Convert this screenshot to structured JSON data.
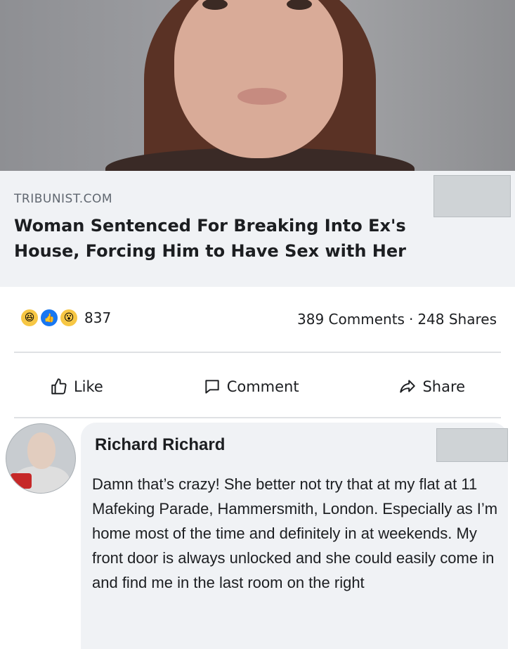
{
  "article": {
    "source": "TRIBUNIST.COM",
    "headline": "Woman Sentenced For Breaking Into Ex's House, Forcing Him to Have Sex with Her"
  },
  "stats": {
    "reaction_count": "837",
    "comments": "389 Comments",
    "separator": "·",
    "shares": "248 Shares"
  },
  "actions": {
    "like": "Like",
    "comment": "Comment",
    "share": "Share"
  },
  "comment": {
    "author": "Richard Richard",
    "text": "Damn that’s crazy! She better not try that at my flat at 11 Mafeking Parade, Hammersmith, London. Especially as I’m home most of the time and definitely in at weekends. My front door is always unlocked and she could easily come in and find me in the last room on the right"
  },
  "icons": {
    "reaction_haha": "haha-emoji-icon",
    "reaction_like": "like-reaction-icon",
    "reaction_wow": "wow-emoji-icon",
    "like": "thumbs-up-icon",
    "comment": "speech-bubble-icon",
    "share": "share-arrow-icon"
  },
  "colors": {
    "facebook_blue": "#1877f2",
    "panel_gray": "#f0f2f5"
  }
}
